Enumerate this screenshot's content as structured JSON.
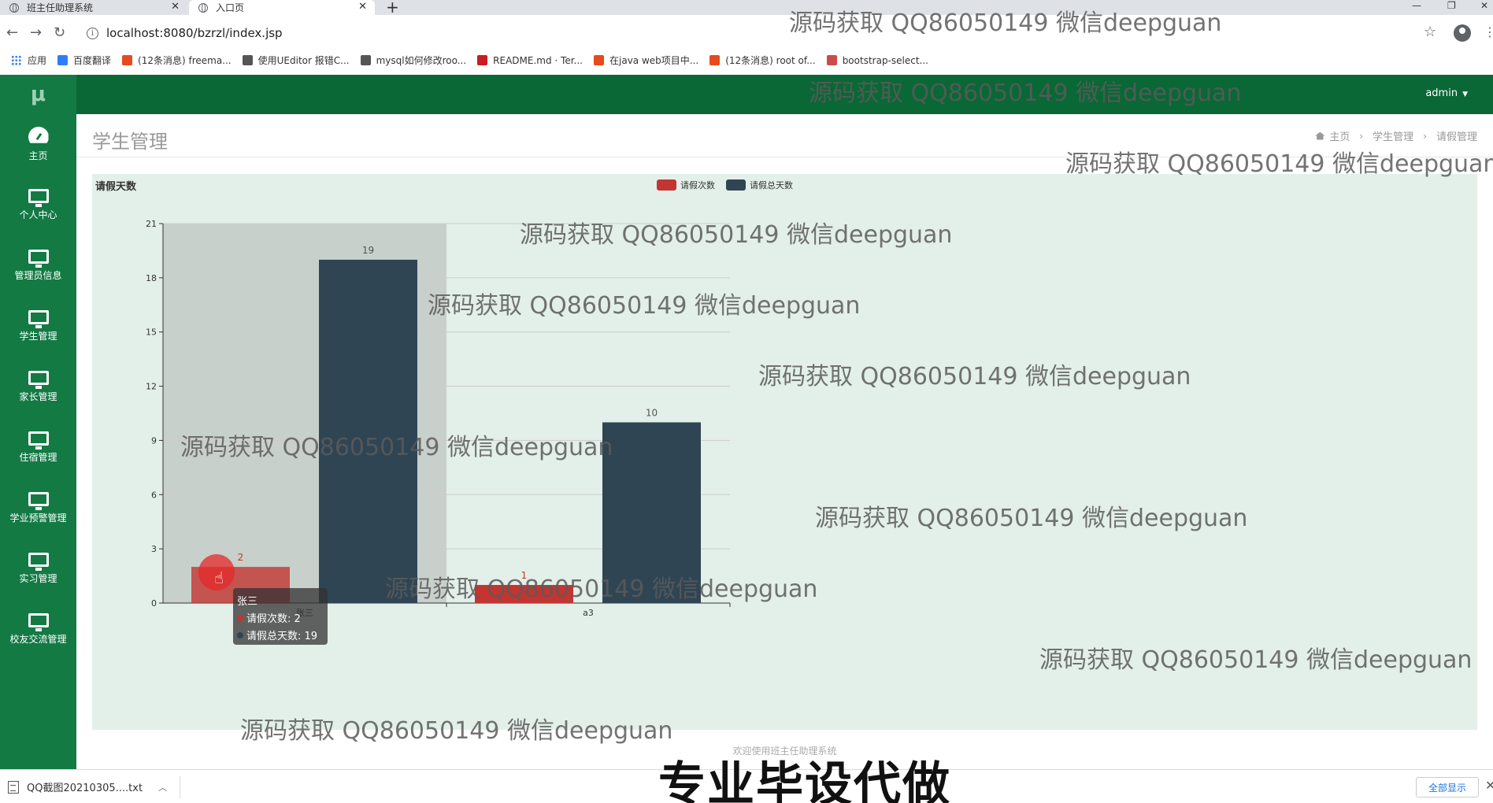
{
  "browser": {
    "tabs": [
      {
        "title": "班主任助理系统",
        "active": false
      },
      {
        "title": "入口页",
        "active": true
      }
    ],
    "url": "localhost:8080/bzrzl/index.jsp",
    "bookmarks": [
      {
        "label": "应用",
        "icon": "apps-grid-icon",
        "color": "#4285f4"
      },
      {
        "label": "百度翻译",
        "icon": "baidu-translate-icon",
        "color": "#2f7df6"
      },
      {
        "label": "(12条消息) freema...",
        "icon": "csdn-icon",
        "color": "#e8491d"
      },
      {
        "label": "使用UEditor 报错C...",
        "icon": "link-icon",
        "color": "#555555"
      },
      {
        "label": "mysql如何修改roo...",
        "icon": "link-icon",
        "color": "#555555"
      },
      {
        "label": "README.md · Ter...",
        "icon": "gitee-icon",
        "color": "#c71d23"
      },
      {
        "label": "在java web项目中...",
        "icon": "csdn-icon",
        "color": "#e8491d"
      },
      {
        "label": "(12条消息) root of...",
        "icon": "csdn-icon",
        "color": "#e8491d"
      },
      {
        "label": "bootstrap-select...",
        "icon": "cnblogs-icon",
        "color": "#cc4b4b"
      }
    ]
  },
  "app": {
    "logo": "μ",
    "user": "admin",
    "sidebar": [
      {
        "label": "主页",
        "icon": "dashboard-icon"
      },
      {
        "label": "个人中心",
        "icon": "monitor-icon"
      },
      {
        "label": "管理员信息",
        "icon": "monitor-icon"
      },
      {
        "label": "学生管理",
        "icon": "monitor-icon"
      },
      {
        "label": "家长管理",
        "icon": "monitor-icon"
      },
      {
        "label": "住宿管理",
        "icon": "monitor-icon"
      },
      {
        "label": "学业预警管理",
        "icon": "monitor-icon"
      },
      {
        "label": "实习管理",
        "icon": "monitor-icon"
      },
      {
        "label": "校友交流管理",
        "icon": "monitor-icon"
      }
    ],
    "page_title": "学生管理",
    "breadcrumb": [
      "主页",
      "学生管理",
      "请假管理"
    ],
    "footer": "欢迎使用班主任助理系统"
  },
  "chart_data": {
    "type": "bar",
    "title": "请假天数",
    "categories": [
      "张三",
      "a3"
    ],
    "series": [
      {
        "name": "请假次数",
        "color": "#c23531",
        "values": [
          2,
          1
        ]
      },
      {
        "name": "请假总天数",
        "color": "#2f4554",
        "values": [
          19,
          10
        ]
      }
    ],
    "ylim": [
      0,
      21
    ],
    "yticks": [
      0,
      3,
      6,
      9,
      12,
      15,
      18,
      21
    ],
    "legend": "top-center",
    "grid": true,
    "highlighted_category": "张三"
  },
  "tooltip": {
    "title": "张三",
    "rows": [
      "请假次数: 2",
      "请假总天数: 19"
    ]
  },
  "downloads": {
    "file": "QQ截图20210305....txt",
    "show_all": "全部显示"
  },
  "overlay": {
    "watermark": "源码获取 QQ86050149 微信deepguan",
    "banner": "专业毕设代做"
  }
}
